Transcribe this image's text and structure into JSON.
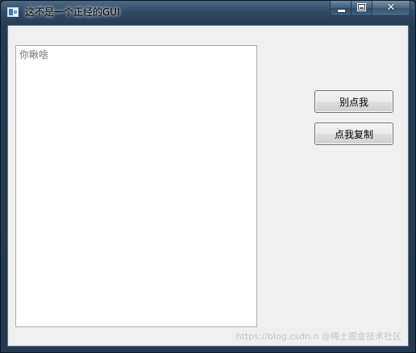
{
  "window": {
    "title": "这不是一个正经的GUI",
    "controls": {
      "minimize": "minimize",
      "maximize": "maximize",
      "close": "✕"
    }
  },
  "main": {
    "text_area": {
      "placeholder": "你瞅啥",
      "value": ""
    },
    "buttons": {
      "dont_click_label": "别点我",
      "copy_label": "点我复制"
    }
  },
  "watermark": "https://blog.csdn.n @稀土掘金技术社区",
  "colors": {
    "client_bg": "#f0f0f0",
    "titlebar": "#2f4a63",
    "button_border": "#707070"
  },
  "icons": {
    "app": "app-window-icon",
    "minimize": "minimize-icon",
    "maximize": "maximize-icon",
    "close": "close-icon"
  }
}
